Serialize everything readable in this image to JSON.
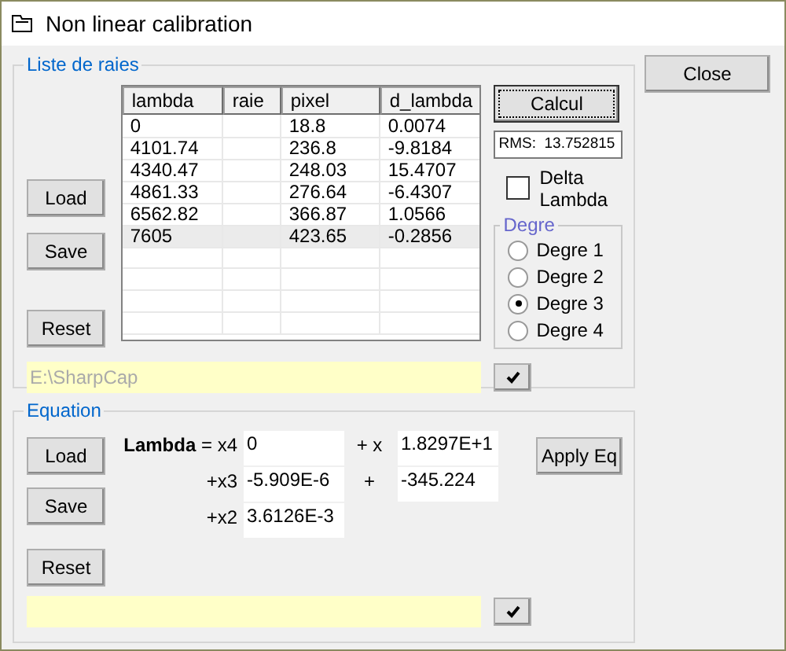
{
  "window": {
    "title": "Non linear calibration"
  },
  "close_button": "Close",
  "lines_group": {
    "title": "Liste de raies",
    "buttons": [
      "Load",
      "Save",
      "Reset"
    ],
    "table": {
      "columns": [
        "lambda",
        "raie",
        "pixel",
        "d_lambda"
      ],
      "rows": [
        {
          "cells": [
            "0",
            "",
            "18.8",
            "0.0074"
          ],
          "selected": false
        },
        {
          "cells": [
            "4101.74",
            "",
            "236.8",
            "-9.8184"
          ],
          "selected": false
        },
        {
          "cells": [
            "4340.47",
            "",
            "248.03",
            "15.4707"
          ],
          "selected": false
        },
        {
          "cells": [
            "4861.33",
            "",
            "276.64",
            "-6.4307"
          ],
          "selected": false
        },
        {
          "cells": [
            "6562.82",
            "",
            "366.87",
            "1.0566"
          ],
          "selected": false
        },
        {
          "cells": [
            "7605",
            "",
            "423.65",
            "-0.2856"
          ],
          "selected": true
        }
      ]
    },
    "calcul_button": "Calcul",
    "rms": "RMS:  13.752815",
    "delta_lambda": {
      "label": "Delta Lambda",
      "checked": false
    },
    "degree_group": {
      "title": "Degre",
      "options": [
        {
          "label": "Degre 1",
          "selected": false
        },
        {
          "label": "Degre 2",
          "selected": false
        },
        {
          "label": "Degre 3",
          "selected": true
        },
        {
          "label": "Degre 4",
          "selected": false
        }
      ]
    },
    "path": "E:\\SharpCap"
  },
  "equation_group": {
    "title": "Equation",
    "buttons": [
      "Load",
      "Save",
      "Reset"
    ],
    "terms": [
      {
        "label": "**Lambda** = x4",
        "value": "0"
      },
      {
        "label": "+x3",
        "value": "-5.909E-6"
      },
      {
        "label": "+x2",
        "value": "3.6126E-3"
      },
      {
        "label": "+ x",
        "value": "1.8297E+1"
      },
      {
        "label": "+",
        "value": "-345.224"
      }
    ],
    "apply_button": "Apply Eq"
  }
}
